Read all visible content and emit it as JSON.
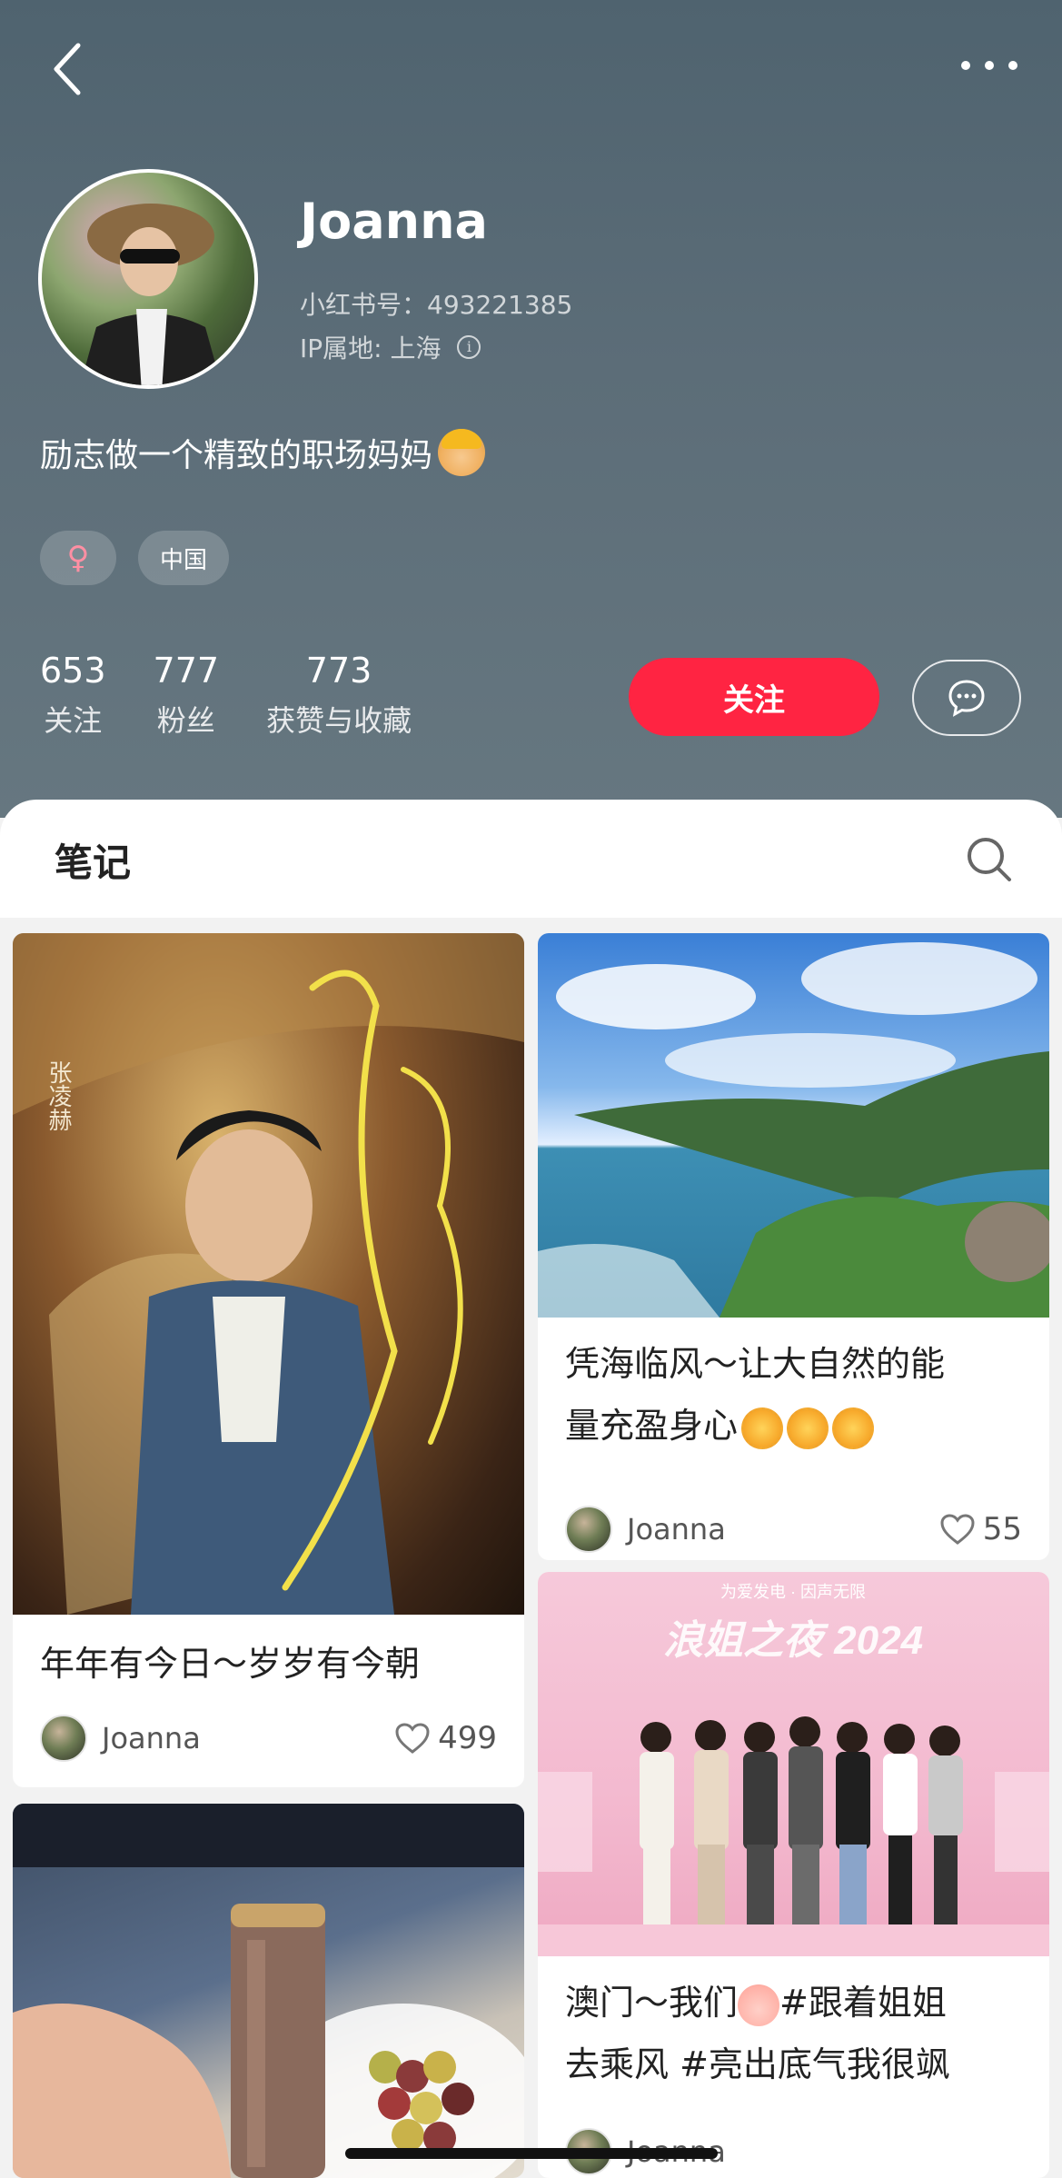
{
  "header": {
    "username": "Joanna",
    "id_line": "小红书号：493221385",
    "ip_label": "IP属地: 上海",
    "bio": "励志做一个精致的职场妈妈",
    "tags": [
      "♀",
      "中国"
    ],
    "stats": [
      {
        "num": "653",
        "label": "关注"
      },
      {
        "num": "777",
        "label": "粉丝"
      },
      {
        "num": "773",
        "label": "获赞与收藏"
      }
    ],
    "follow_label": "关注"
  },
  "notes": {
    "title": "笔记",
    "cards": [
      {
        "title": "年年有今日～岁岁有今朝",
        "author": "Joanna",
        "likes": "499"
      },
      {
        "title_line1": "凭海临风～让大自然的能",
        "title_line2": "量充盈身心",
        "author": "Joanna",
        "likes": "55"
      },
      {
        "title_line1": "澳门～我们",
        "title_line1_tail": "#跟着姐姐",
        "title_line2": "去乘风 #亮出底气我很飒",
        "author": "Joanna"
      },
      {
        "image_only": true
      }
    ],
    "poster_text": {
      "name_vertical": "张凌赫",
      "event_banner": "为爱发电 · 因声无限",
      "event_title": "浪姐之夜 2024"
    }
  },
  "colors": {
    "accent": "#ff2442",
    "header_bg": "#5c6d78"
  },
  "icons": {
    "back": "chevron-left-icon",
    "more": "more-dots-icon",
    "message": "chat-bubble-icon",
    "search": "search-icon",
    "like": "heart-outline-icon"
  }
}
